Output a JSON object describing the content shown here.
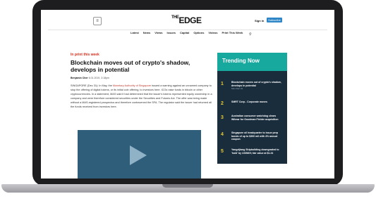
{
  "header": {
    "logo_text": "THE EDGE",
    "logo_the": "THE",
    "logo_edge": "EDGE",
    "signin_label": "Sign in",
    "subscribe_label": "Subscribe"
  },
  "nav": {
    "items": [
      "Latest",
      "News",
      "Views",
      "Issues",
      "Capital",
      "Options",
      "Videos",
      "Print This Week"
    ]
  },
  "article": {
    "kicker": "In print this week",
    "headline": "Blockchain moves out of crypto's shadow, develops in potential",
    "author": "Benjamin Cher",
    "date": "6.01.2019, 3:18pm",
    "body_1": "SINGAPORE (Dec 31): In May, the ",
    "body_link": "Monetary Authority of Singapore",
    "body_2": " issued a warning against an unnamed company to stop the offering of digital tokens, or its initial coin offering, to investors here. ICOs raise funds in bitcoin or other cryptocurrencies. In a statement, MAS said it had determined that the issuer's tokens represented equity ownership in a company and were therefore considered securities under the Securities and Futures Act. The offer was being made without a MAS-registered prospectus and therefore contravened the SFA. The regulator said the issuer had returned all the funds received from investors here."
  },
  "trending": {
    "title": "Trending Now",
    "items": [
      {
        "num": "1",
        "text": "Blockchain moves out of crypto's shadow, develops in potential",
        "date": "Mon Dec 31"
      },
      {
        "num": "2",
        "text": "SMRT Corp - Corporate moves",
        "date": ""
      },
      {
        "num": "3",
        "text": "Australian consumer watchdog clears Wilmar for Goodman Fielder acquisition",
        "date": ""
      },
      {
        "num": "4",
        "text": "Singapore oil headquarter to issue perp bonds of up to $300 mil with 4% annual coupon",
        "date": ""
      },
      {
        "num": "5",
        "text": "Yangzijiang Shipbuilding downgraded to 'hold' by UOBKH; fair value at $1.24",
        "date": ""
      }
    ]
  },
  "colors": {
    "accent_teal": "#17a89e",
    "panel_dark": "#1a2d3d",
    "kicker_red": "#d9301e",
    "trending_number": "#e8c930",
    "subscribe_blue": "#2f86c6"
  }
}
